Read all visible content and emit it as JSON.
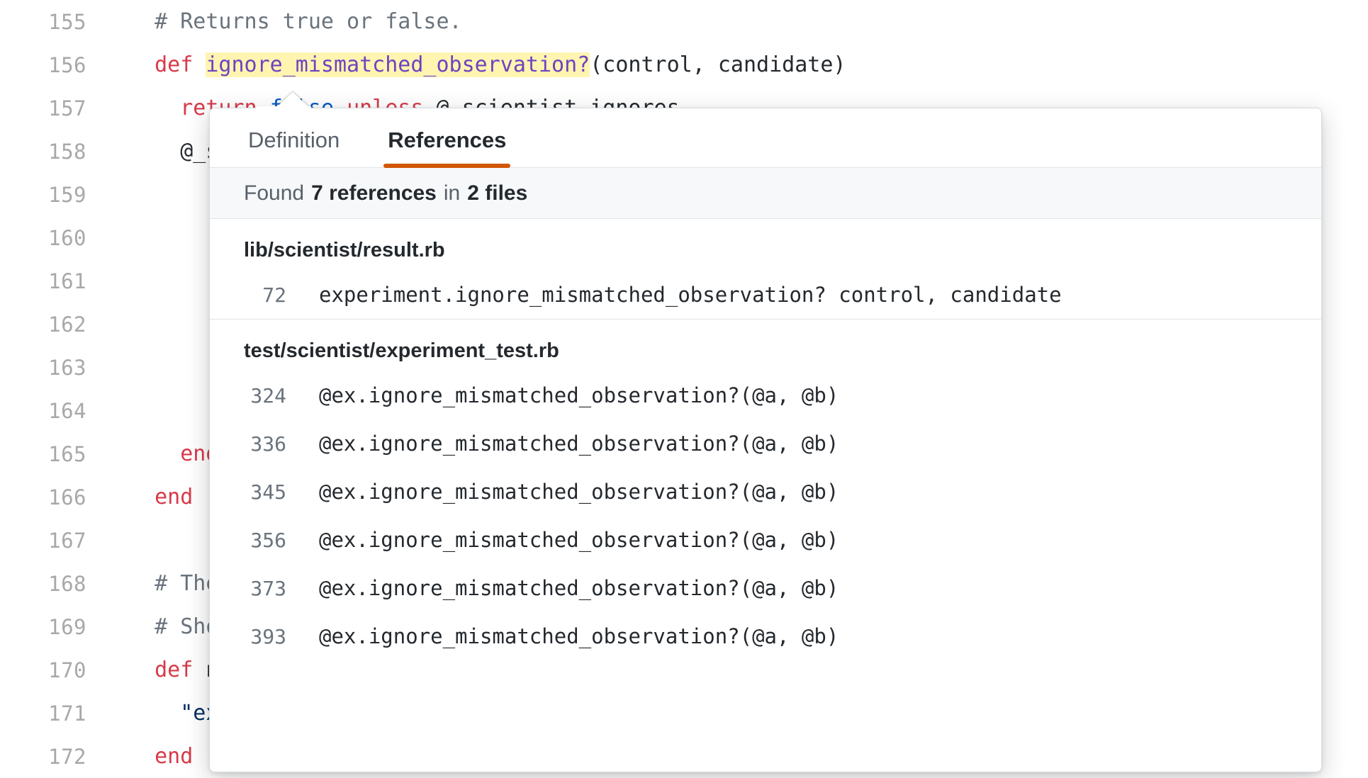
{
  "editor": {
    "lines": [
      {
        "num": "155",
        "segments": [
          {
            "text": "  # Returns true or false.",
            "cls": "cmt"
          }
        ]
      },
      {
        "num": "156",
        "segments": [
          {
            "text": "  ",
            "cls": ""
          },
          {
            "text": "def",
            "cls": "kw"
          },
          {
            "text": " ",
            "cls": ""
          },
          {
            "text": "ignore_mismatched_observation?",
            "cls": "fn hl"
          },
          {
            "text": "(control, candidate)",
            "cls": ""
          }
        ]
      },
      {
        "num": "157",
        "segments": [
          {
            "text": "    ",
            "cls": ""
          },
          {
            "text": "return",
            "cls": "kw"
          },
          {
            "text": " ",
            "cls": ""
          },
          {
            "text": "false",
            "cls": "cnst"
          },
          {
            "text": " ",
            "cls": ""
          },
          {
            "text": "unless",
            "cls": "kw"
          },
          {
            "text": " @_scientist_ignores",
            "cls": ""
          }
        ]
      },
      {
        "num": "158",
        "segments": [
          {
            "text": "    @_scientist_ignores.any? do |ignore|",
            "cls": ""
          }
        ]
      },
      {
        "num": "159",
        "segments": [
          {
            "text": "",
            "cls": ""
          }
        ]
      },
      {
        "num": "160",
        "segments": [
          {
            "text": "",
            "cls": ""
          }
        ]
      },
      {
        "num": "161",
        "segments": [
          {
            "text": "",
            "cls": ""
          }
        ]
      },
      {
        "num": "162",
        "segments": [
          {
            "text": "",
            "cls": ""
          }
        ]
      },
      {
        "num": "163",
        "segments": [
          {
            "text": "",
            "cls": ""
          }
        ]
      },
      {
        "num": "164",
        "segments": [
          {
            "text": "",
            "cls": ""
          }
        ]
      },
      {
        "num": "165",
        "segments": [
          {
            "text": "    ",
            "cls": ""
          },
          {
            "text": "end",
            "cls": "kw"
          }
        ]
      },
      {
        "num": "166",
        "segments": [
          {
            "text": "  ",
            "cls": ""
          },
          {
            "text": "end",
            "cls": "kw"
          }
        ]
      },
      {
        "num": "167",
        "segments": [
          {
            "text": "",
            "cls": ""
          }
        ]
      },
      {
        "num": "168",
        "segments": [
          {
            "text": "  # The String name of this experiment. Default is \"experiment\".",
            "cls": "cmt"
          }
        ]
      },
      {
        "num": "169",
        "segments": [
          {
            "text": "  # Should be overridden in subclasses.",
            "cls": "cmt"
          }
        ]
      },
      {
        "num": "170",
        "segments": [
          {
            "text": "  ",
            "cls": ""
          },
          {
            "text": "def",
            "cls": "kw"
          },
          {
            "text": " name",
            "cls": ""
          }
        ]
      },
      {
        "num": "171",
        "segments": [
          {
            "text": "    ",
            "cls": ""
          },
          {
            "text": "\"experiment\"",
            "cls": "str"
          }
        ]
      },
      {
        "num": "172",
        "segments": [
          {
            "text": "  ",
            "cls": ""
          },
          {
            "text": "end",
            "cls": "kw"
          }
        ]
      }
    ]
  },
  "popup": {
    "tabs": [
      {
        "label": "Definition",
        "active": false
      },
      {
        "label": "References",
        "active": true
      }
    ],
    "accent_color": "#d15704",
    "found": {
      "prefix": "Found",
      "count": "7 references",
      "middle": "in",
      "files": "2 files"
    },
    "groups": [
      {
        "file": "lib/scientist/result.rb",
        "rows": [
          {
            "line": "72",
            "code": "experiment.ignore_mismatched_observation? control, candidate"
          }
        ]
      },
      {
        "file": "test/scientist/experiment_test.rb",
        "rows": [
          {
            "line": "324",
            "code": "@ex.ignore_mismatched_observation?(@a, @b)"
          },
          {
            "line": "336",
            "code": "@ex.ignore_mismatched_observation?(@a, @b)"
          },
          {
            "line": "345",
            "code": "@ex.ignore_mismatched_observation?(@a, @b)"
          },
          {
            "line": "356",
            "code": "@ex.ignore_mismatched_observation?(@a, @b)"
          },
          {
            "line": "373",
            "code": "@ex.ignore_mismatched_observation?(@a, @b)"
          },
          {
            "line": "393",
            "code": "@ex.ignore_mismatched_observation?(@a, @b)"
          }
        ]
      }
    ]
  }
}
